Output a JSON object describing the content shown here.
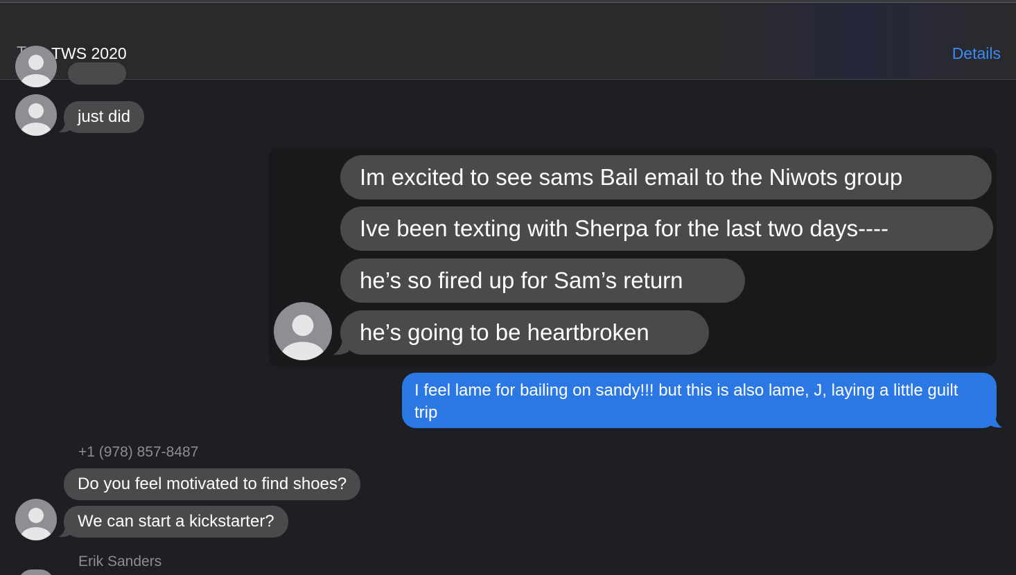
{
  "header": {
    "to_label": "To:",
    "to_value": "TWS 2020",
    "details_label": "Details"
  },
  "messages": {
    "m1": "just did",
    "quoted": [
      "Im excited to see sams Bail email to the Niwots group",
      "Ive been texting with Sherpa for the last two days----",
      "he’s so fired up for Sam’s return",
      "he’s going to be heartbroken"
    ],
    "sent": "I feel lame for bailing on sandy!!! but this is also lame, J, laying a little guilt trip",
    "sender_phone": "+1 (978) 857-8487",
    "m_shoes": "Do you feel motivated to find shoes?",
    "m_kick": "We can start a kickstarter?",
    "sender_erik": "Erik Sanders"
  },
  "colors": {
    "accent": "#3b8cf2",
    "sent_bubble": "#2b77e3",
    "received_bubble": "#4a4a4d",
    "background": "#1e1f22"
  }
}
